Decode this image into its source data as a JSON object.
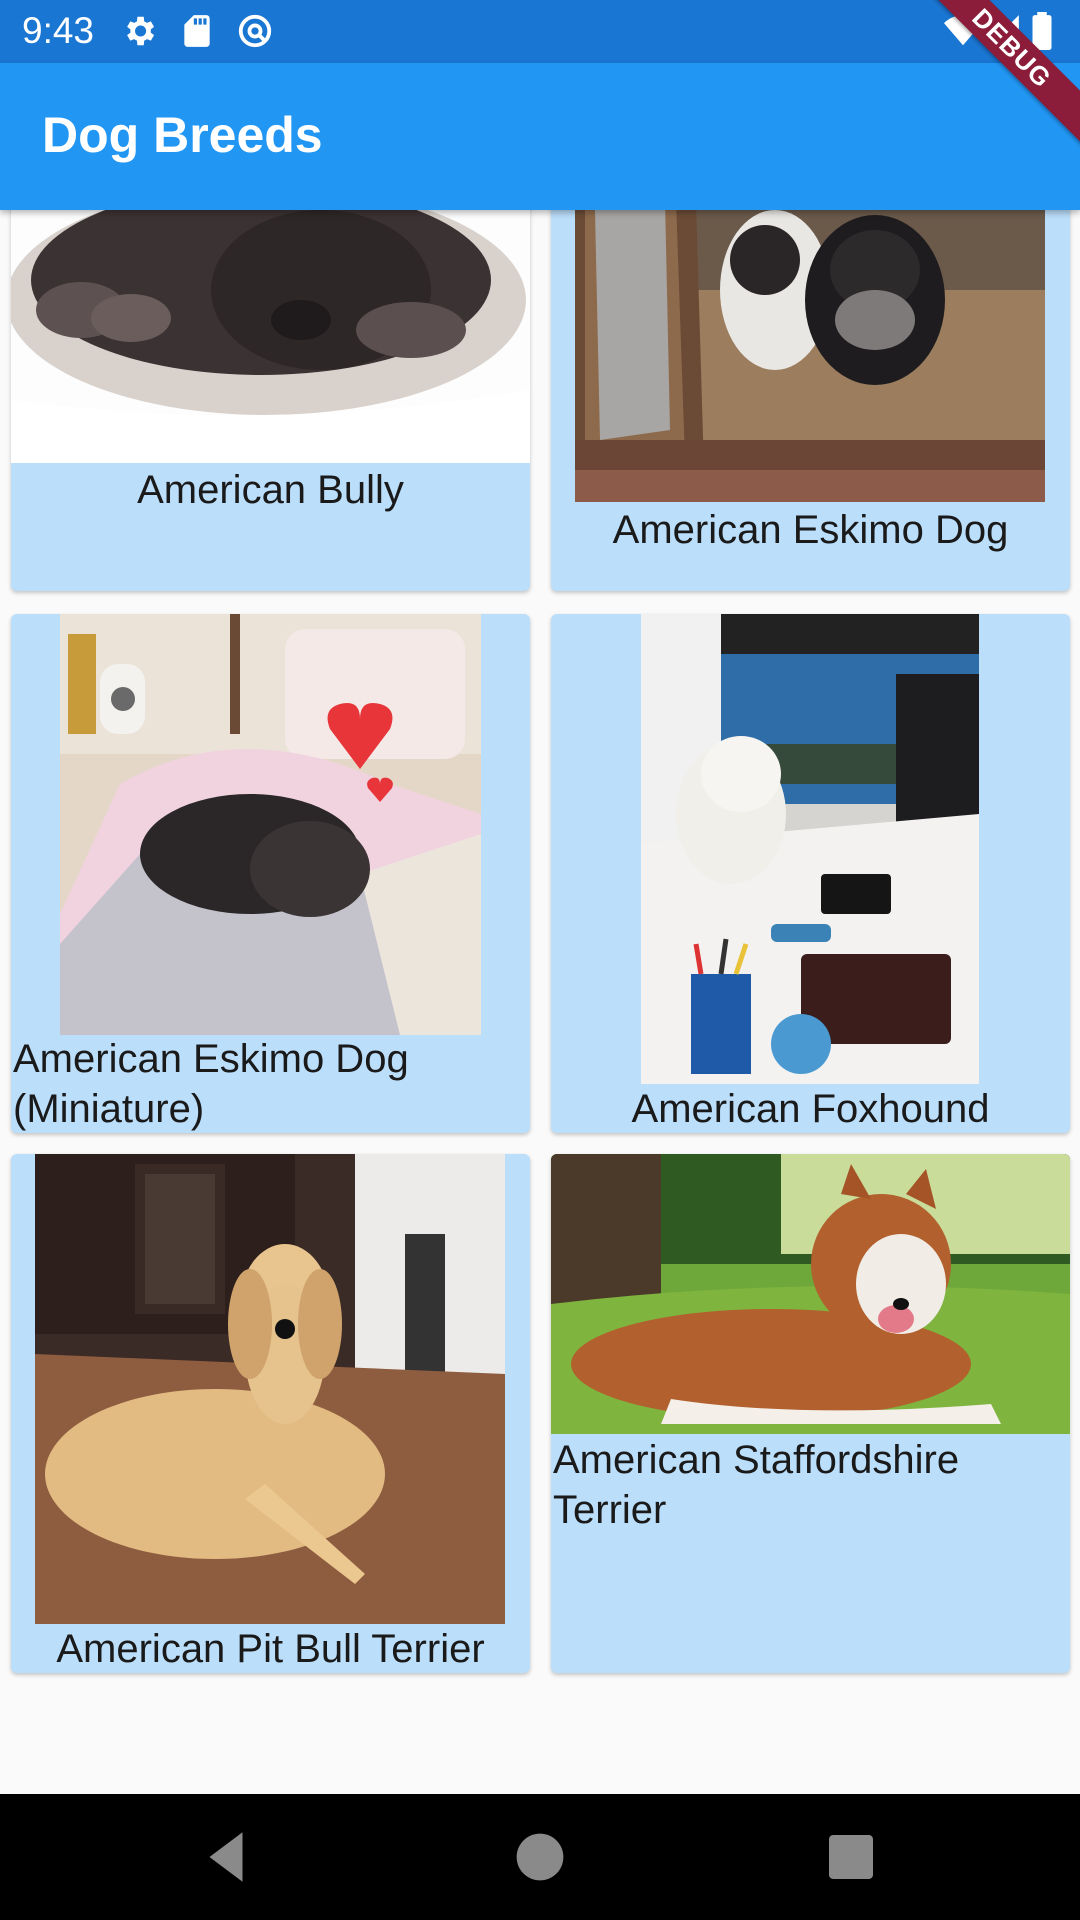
{
  "status_bar": {
    "time": "9:43",
    "icons": [
      "settings-icon",
      "sd-card-icon",
      "at-sign-icon",
      "wifi-icon",
      "signal-icon",
      "battery-icon"
    ]
  },
  "app_bar": {
    "title": "Dog Breeds"
  },
  "debug_banner": "DEBUG",
  "breeds": [
    {
      "name": "American Bully"
    },
    {
      "name": "American Eskimo Dog"
    },
    {
      "name": "American Eskimo Dog (Miniature)"
    },
    {
      "name": "American Foxhound"
    },
    {
      "name": "American Pit Bull Terrier"
    },
    {
      "name": "American Staffordshire Terrier"
    }
  ],
  "nav_bar": {
    "buttons": [
      "back-icon",
      "home-icon",
      "recents-icon"
    ]
  },
  "colors": {
    "status_bar": "#1976d2",
    "app_bar": "#2196f3",
    "card_background": "#bbdefb",
    "page_background": "#fafafa",
    "debug_banner": "#8b1c3a"
  }
}
